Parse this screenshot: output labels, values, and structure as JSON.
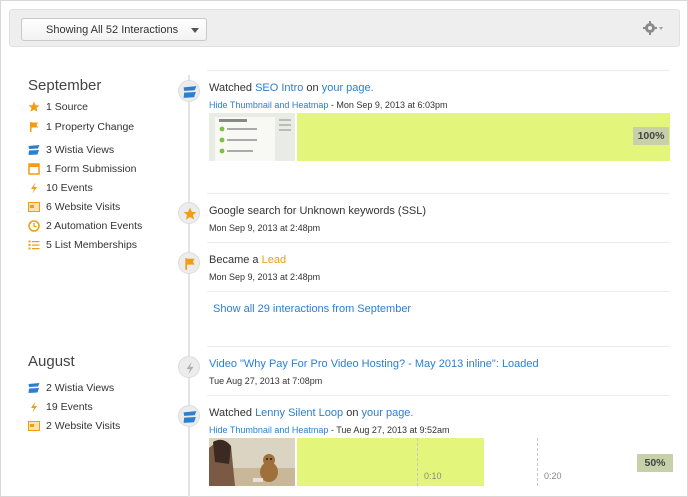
{
  "toolbar": {
    "filter_label": "Showing All 52 Interactions",
    "settings_icon": "gear-icon"
  },
  "sidebar": {
    "september": {
      "title": "September",
      "items": [
        {
          "icon": "star-icon",
          "label": "1 Source",
          "color": "#f39c12"
        },
        {
          "icon": "flag-icon",
          "label": "1 Property Change",
          "color": "#f39c12"
        },
        {
          "icon": "wistia-icon",
          "label": "3 Wistia Views",
          "color": "#2a7fd0"
        },
        {
          "icon": "form-icon",
          "label": "1 Form Submission",
          "color": "#f39c12"
        },
        {
          "icon": "lightning-icon",
          "label": "10 Events",
          "color": "#f39c12"
        },
        {
          "icon": "website-icon",
          "label": "6 Website Visits",
          "color": "#f39c12"
        },
        {
          "icon": "clock-icon",
          "label": "2 Automation Events",
          "color": "#f39c12"
        },
        {
          "icon": "list-icon",
          "label": "5 List Memberships",
          "color": "#f39c12"
        }
      ]
    },
    "august": {
      "title": "August",
      "items": [
        {
          "icon": "wistia-icon",
          "label": "2 Wistia Views",
          "color": "#2a7fd0"
        },
        {
          "icon": "lightning-icon",
          "label": "19 Events",
          "color": "#f39c12"
        },
        {
          "icon": "website-icon",
          "label": "2 Website Visits",
          "color": "#f39c12"
        }
      ]
    }
  },
  "timeline": {
    "item1": {
      "prefix": "Watched ",
      "video": "SEO Intro",
      "mid": " on ",
      "page": "your page.",
      "hide_link": "Hide Thumbnail and Heatmap",
      "date": " - Mon Sep 9, 2013 at 6:03pm",
      "percent": "100%",
      "watched_fraction": 1.0
    },
    "item2": {
      "title": "Google search for Unknown keywords (SSL)",
      "date": "Mon Sep 9, 2013 at 2:48pm"
    },
    "item3": {
      "prefix": "Became a ",
      "status": "Lead",
      "date": "Mon Sep 9, 2013 at 2:48pm"
    },
    "show_all": "Show all 29 interactions from September",
    "item4": {
      "title": "Video \"Why Pay For Pro Video Hosting? - May 2013 inline\": Loaded",
      "date": "Tue Aug 27, 2013 at 7:08pm"
    },
    "item5": {
      "prefix": "Watched ",
      "video": "Lenny Silent Loop",
      "mid": " on ",
      "page": "your page.",
      "hide_link": "Hide Thumbnail and Heatmap",
      "date": " - Tue Aug 27, 2013 at 9:52am",
      "percent": "50%",
      "watched_fraction": 0.5,
      "tick1": "0:10",
      "tick2": "0:20"
    }
  },
  "colors": {
    "heat": "#e4f57b",
    "link": "#2a7fd0",
    "accent": "#f39c12"
  }
}
